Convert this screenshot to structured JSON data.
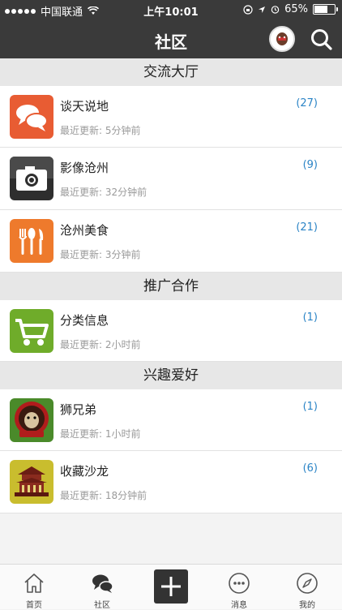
{
  "status": {
    "carrier": "中国联通",
    "time": "上午10:01",
    "battery": "65%",
    "battery_level": 0.65
  },
  "header": {
    "title": "社区"
  },
  "sections": [
    {
      "title": "交流大厅",
      "items": [
        {
          "name": "谈天说地",
          "updated": "最近更新: 5分钟前",
          "count": "(27)",
          "icon": "chat-bubbles-icon",
          "color": "#e85c33"
        },
        {
          "name": "影像沧州",
          "updated": "最近更新: 32分钟前",
          "count": "(9)",
          "icon": "camera-icon",
          "color": "#333333"
        },
        {
          "name": "沧州美食",
          "updated": "最近更新: 3分钟前",
          "count": "(21)",
          "icon": "cutlery-icon",
          "color": "#ee7a2c"
        }
      ]
    },
    {
      "title": "推广合作",
      "items": [
        {
          "name": "分类信息",
          "updated": "最近更新: 2小时前",
          "count": "(1)",
          "icon": "shopping-cart-icon",
          "color": "#6fac2a"
        }
      ]
    },
    {
      "title": "兴趣爱好",
      "items": [
        {
          "name": "狮兄弟",
          "updated": "最近更新: 1小时前",
          "count": "(1)",
          "icon": "lion-logo-icon",
          "color": "#4a8a2a"
        },
        {
          "name": "收藏沙龙",
          "updated": "最近更新: 18分钟前",
          "count": "(6)",
          "icon": "pavilion-icon",
          "color": "#c9bd2e"
        }
      ]
    }
  ],
  "tabs": [
    {
      "label": "首页",
      "icon": "home-icon"
    },
    {
      "label": "社区",
      "icon": "community-icon"
    },
    {
      "label": "",
      "icon": "plus-icon"
    },
    {
      "label": "消息",
      "icon": "message-icon"
    },
    {
      "label": "我的",
      "icon": "compass-icon"
    }
  ],
  "accent_color": "#2b84c6"
}
